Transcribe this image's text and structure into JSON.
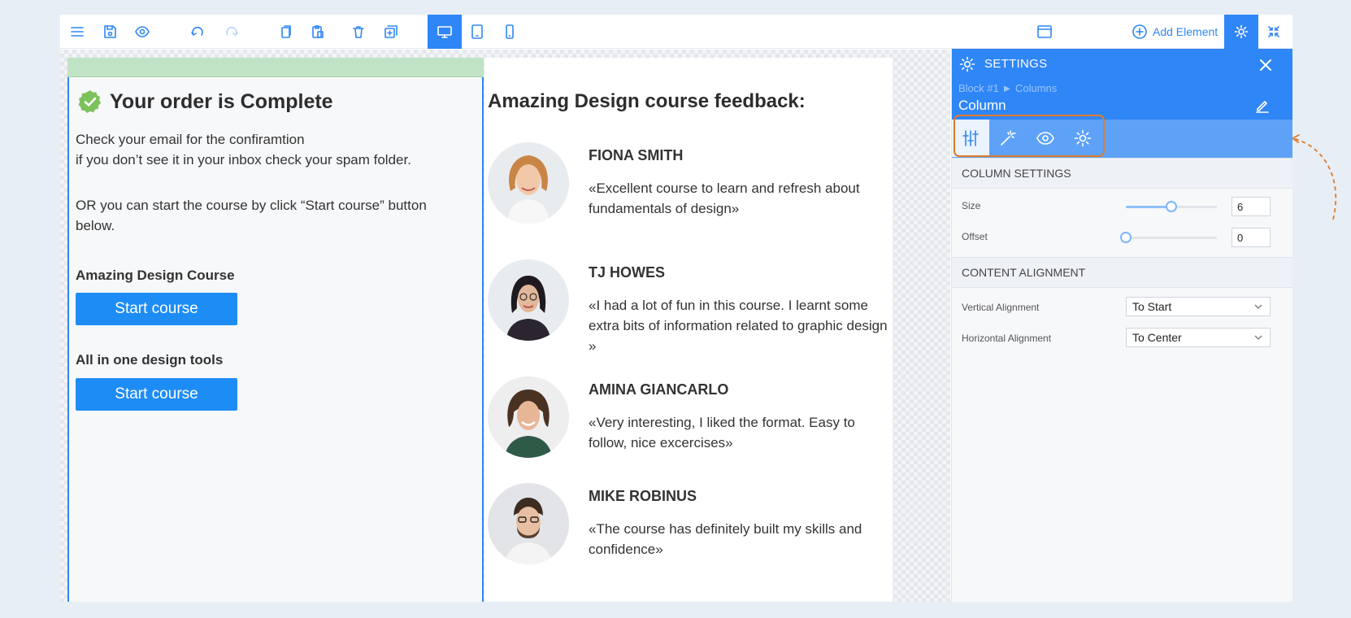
{
  "toolbar": {
    "add_element_label": "Add Element",
    "icons": [
      "menu-icon",
      "save-icon",
      "preview-icon",
      "undo-icon",
      "redo-icon",
      "copy-icon",
      "paste-icon",
      "delete-icon",
      "duplicate-icon",
      "desktop-icon",
      "tablet-icon",
      "mobile-icon",
      "window-icon",
      "settings-icon",
      "collapse-icon"
    ]
  },
  "left_column": {
    "title": "Your order is Complete",
    "line1": "Check your email for the confiramtion",
    "line2": "if you don’t see it in your inbox check your spam folder.",
    "paragraph2": "OR you can start the course by click “Start course” button below.",
    "course1_heading": "Amazing Design Course",
    "course1_button": "Start course",
    "course2_heading": "All in one design tools",
    "course2_button": "Start course"
  },
  "feedback": {
    "title": "Amazing Design course feedback:",
    "items": [
      {
        "name": "FIONA SMITH",
        "quote": "«Excellent course to learn and refresh about fundamentals of design»"
      },
      {
        "name": "TJ HOWES",
        "quote": "«I had a lot of fun in this course. I learnt some extra bits of information related to graphic design »"
      },
      {
        "name": "AMINA GIANCARLO",
        "quote": "«Very interesting, I liked the format. Easy to follow, nice excercises»"
      },
      {
        "name": "MIKE ROBINUS",
        "quote": "«The course has definitely built my skills and confidence»"
      }
    ]
  },
  "settings": {
    "title": "SETTINGS",
    "breadcrumb": "Block #1 ► Columns",
    "element_name": "Column",
    "column_settings_label": "COLUMN SETTINGS",
    "size_label": "Size",
    "size_value": "6",
    "size_fraction": 0.5,
    "offset_label": "Offset",
    "offset_value": "0",
    "offset_fraction": 0,
    "content_alignment_label": "CONTENT ALIGNMENT",
    "vertical_label": "Vertical Alignment",
    "vertical_value": "To Start",
    "horizontal_label": "Horizontal Alignment",
    "horizontal_value": "To Center"
  },
  "colors": {
    "accent": "#2f86f6",
    "button": "#1e8cf5",
    "success": "#7cc25a",
    "highlight_outline": "#e07b2a"
  }
}
